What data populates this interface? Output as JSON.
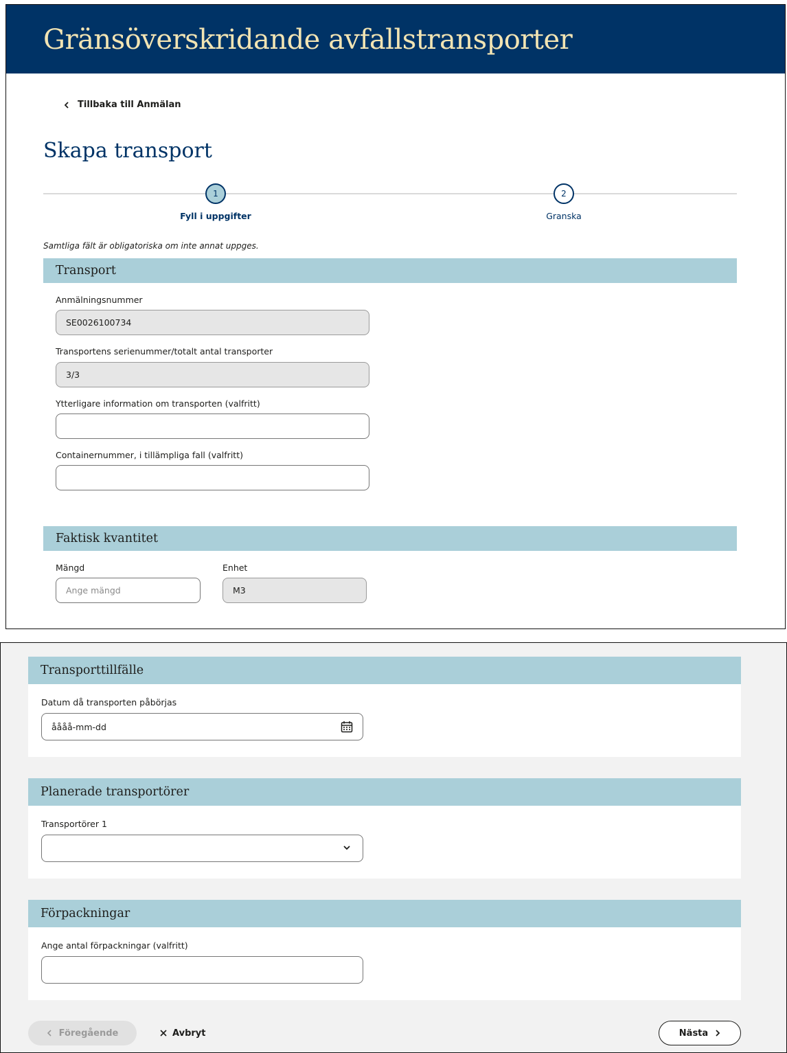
{
  "header": {
    "title": "Gränsöverskridande avfallstransporter"
  },
  "nav": {
    "back_label": "Tillbaka till Anmälan"
  },
  "page": {
    "title": "Skapa transport",
    "hint": "Samtliga fält är obligatoriska om inte annat uppges."
  },
  "stepper": {
    "steps": [
      {
        "number": "1",
        "label": "Fyll i uppgifter",
        "active": true
      },
      {
        "number": "2",
        "label": "Granska",
        "active": false
      }
    ]
  },
  "transport": {
    "heading": "Transport",
    "notification_label": "Anmälningsnummer",
    "notification_value": "SE0026100734",
    "serial_label": "Transportens serienummer/totalt antal transporter",
    "serial_value": "3/3",
    "info_label": "Ytterligare information om transporten (valfritt)",
    "info_value": "",
    "container_label": "Containernummer, i tillämpliga fall (valfritt)",
    "container_value": ""
  },
  "quantity": {
    "heading": "Faktisk kvantitet",
    "amount_label": "Mängd",
    "amount_placeholder": "Ange mängd",
    "unit_label": "Enhet",
    "unit_value": "M3"
  },
  "occasion": {
    "heading": "Transporttillfälle",
    "date_label": "Datum då transporten påbörjas",
    "date_placeholder": "åååå-mm-dd"
  },
  "carriers": {
    "heading": "Planerade transportörer",
    "carrier_label": "Transportörer 1",
    "carrier_value": ""
  },
  "packaging": {
    "heading": "Förpackningar",
    "count_label": "Ange antal förpackningar (valfritt)",
    "count_value": ""
  },
  "actions": {
    "prev_label": "Föregående",
    "cancel_label": "Avbryt",
    "next_label": "Nästa"
  },
  "colors": {
    "header_bg": "#003366",
    "header_text": "#f2e4b3",
    "section_head": "#aacfd9",
    "primary": "#003366"
  }
}
